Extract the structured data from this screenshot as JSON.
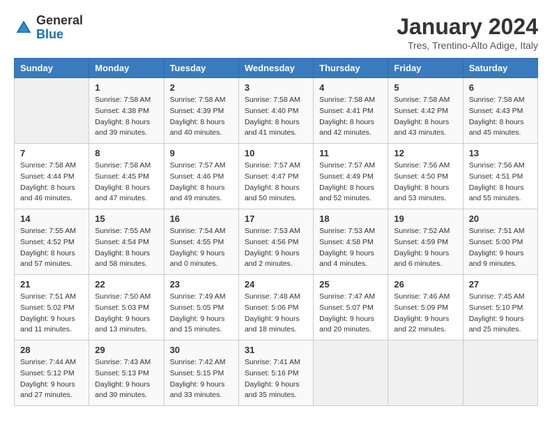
{
  "header": {
    "logo_general": "General",
    "logo_blue": "Blue",
    "month_year": "January 2024",
    "location": "Tres, Trentino-Alto Adige, Italy"
  },
  "days_of_week": [
    "Sunday",
    "Monday",
    "Tuesday",
    "Wednesday",
    "Thursday",
    "Friday",
    "Saturday"
  ],
  "weeks": [
    [
      {
        "day": "",
        "sunrise": "",
        "sunset": "",
        "daylight": ""
      },
      {
        "day": "1",
        "sunrise": "7:58 AM",
        "sunset": "4:38 PM",
        "daylight": "8 hours and 39 minutes."
      },
      {
        "day": "2",
        "sunrise": "7:58 AM",
        "sunset": "4:39 PM",
        "daylight": "8 hours and 40 minutes."
      },
      {
        "day": "3",
        "sunrise": "7:58 AM",
        "sunset": "4:40 PM",
        "daylight": "8 hours and 41 minutes."
      },
      {
        "day": "4",
        "sunrise": "7:58 AM",
        "sunset": "4:41 PM",
        "daylight": "8 hours and 42 minutes."
      },
      {
        "day": "5",
        "sunrise": "7:58 AM",
        "sunset": "4:42 PM",
        "daylight": "8 hours and 43 minutes."
      },
      {
        "day": "6",
        "sunrise": "7:58 AM",
        "sunset": "4:43 PM",
        "daylight": "8 hours and 45 minutes."
      }
    ],
    [
      {
        "day": "7",
        "sunrise": "7:58 AM",
        "sunset": "4:44 PM",
        "daylight": "8 hours and 46 minutes."
      },
      {
        "day": "8",
        "sunrise": "7:58 AM",
        "sunset": "4:45 PM",
        "daylight": "8 hours and 47 minutes."
      },
      {
        "day": "9",
        "sunrise": "7:57 AM",
        "sunset": "4:46 PM",
        "daylight": "8 hours and 49 minutes."
      },
      {
        "day": "10",
        "sunrise": "7:57 AM",
        "sunset": "4:47 PM",
        "daylight": "8 hours and 50 minutes."
      },
      {
        "day": "11",
        "sunrise": "7:57 AM",
        "sunset": "4:49 PM",
        "daylight": "8 hours and 52 minutes."
      },
      {
        "day": "12",
        "sunrise": "7:56 AM",
        "sunset": "4:50 PM",
        "daylight": "8 hours and 53 minutes."
      },
      {
        "day": "13",
        "sunrise": "7:56 AM",
        "sunset": "4:51 PM",
        "daylight": "8 hours and 55 minutes."
      }
    ],
    [
      {
        "day": "14",
        "sunrise": "7:55 AM",
        "sunset": "4:52 PM",
        "daylight": "8 hours and 57 minutes."
      },
      {
        "day": "15",
        "sunrise": "7:55 AM",
        "sunset": "4:54 PM",
        "daylight": "8 hours and 58 minutes."
      },
      {
        "day": "16",
        "sunrise": "7:54 AM",
        "sunset": "4:55 PM",
        "daylight": "9 hours and 0 minutes."
      },
      {
        "day": "17",
        "sunrise": "7:53 AM",
        "sunset": "4:56 PM",
        "daylight": "9 hours and 2 minutes."
      },
      {
        "day": "18",
        "sunrise": "7:53 AM",
        "sunset": "4:58 PM",
        "daylight": "9 hours and 4 minutes."
      },
      {
        "day": "19",
        "sunrise": "7:52 AM",
        "sunset": "4:59 PM",
        "daylight": "9 hours and 6 minutes."
      },
      {
        "day": "20",
        "sunrise": "7:51 AM",
        "sunset": "5:00 PM",
        "daylight": "9 hours and 9 minutes."
      }
    ],
    [
      {
        "day": "21",
        "sunrise": "7:51 AM",
        "sunset": "5:02 PM",
        "daylight": "9 hours and 11 minutes."
      },
      {
        "day": "22",
        "sunrise": "7:50 AM",
        "sunset": "5:03 PM",
        "daylight": "9 hours and 13 minutes."
      },
      {
        "day": "23",
        "sunrise": "7:49 AM",
        "sunset": "5:05 PM",
        "daylight": "9 hours and 15 minutes."
      },
      {
        "day": "24",
        "sunrise": "7:48 AM",
        "sunset": "5:06 PM",
        "daylight": "9 hours and 18 minutes."
      },
      {
        "day": "25",
        "sunrise": "7:47 AM",
        "sunset": "5:07 PM",
        "daylight": "9 hours and 20 minutes."
      },
      {
        "day": "26",
        "sunrise": "7:46 AM",
        "sunset": "5:09 PM",
        "daylight": "9 hours and 22 minutes."
      },
      {
        "day": "27",
        "sunrise": "7:45 AM",
        "sunset": "5:10 PM",
        "daylight": "9 hours and 25 minutes."
      }
    ],
    [
      {
        "day": "28",
        "sunrise": "7:44 AM",
        "sunset": "5:12 PM",
        "daylight": "9 hours and 27 minutes."
      },
      {
        "day": "29",
        "sunrise": "7:43 AM",
        "sunset": "5:13 PM",
        "daylight": "9 hours and 30 minutes."
      },
      {
        "day": "30",
        "sunrise": "7:42 AM",
        "sunset": "5:15 PM",
        "daylight": "9 hours and 33 minutes."
      },
      {
        "day": "31",
        "sunrise": "7:41 AM",
        "sunset": "5:16 PM",
        "daylight": "9 hours and 35 minutes."
      },
      {
        "day": "",
        "sunrise": "",
        "sunset": "",
        "daylight": ""
      },
      {
        "day": "",
        "sunrise": "",
        "sunset": "",
        "daylight": ""
      },
      {
        "day": "",
        "sunrise": "",
        "sunset": "",
        "daylight": ""
      }
    ]
  ]
}
